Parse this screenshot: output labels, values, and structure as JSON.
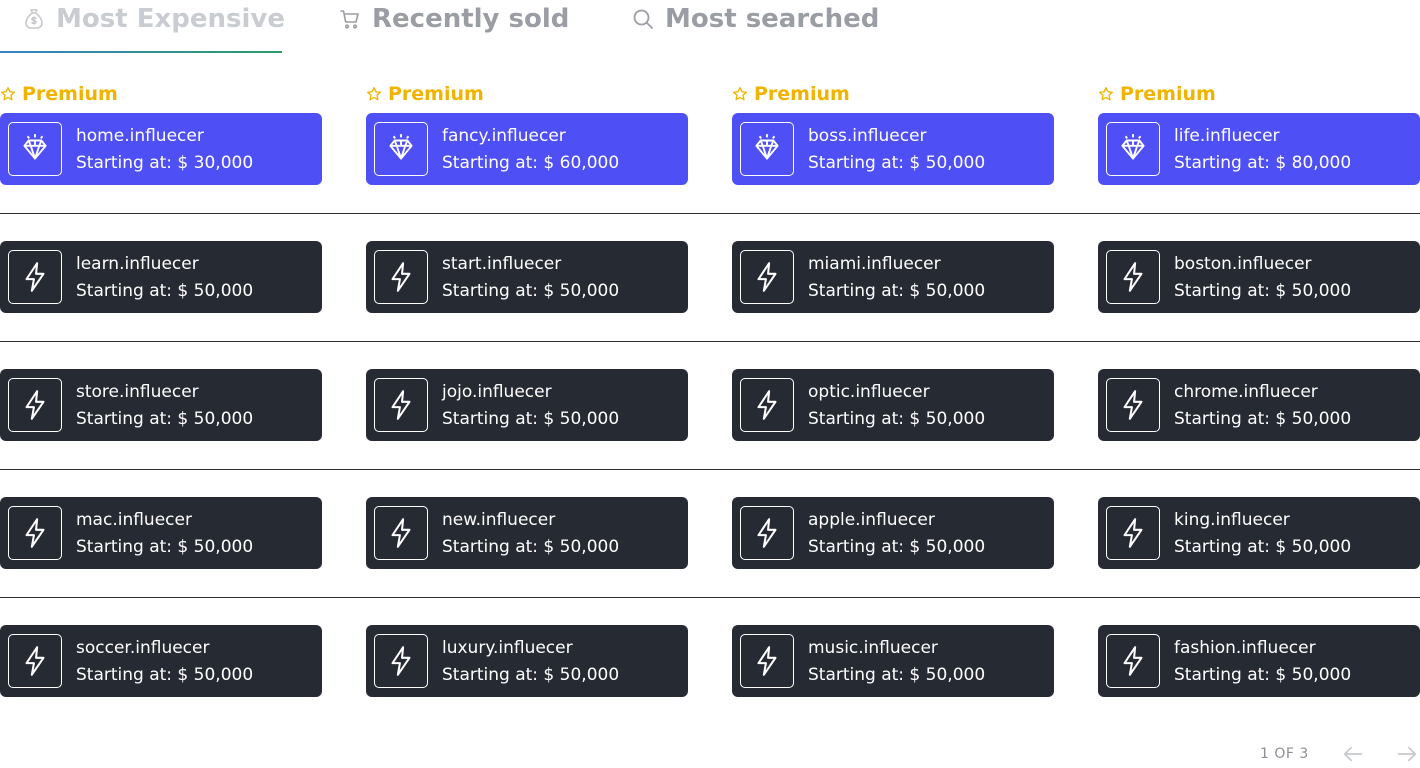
{
  "tabs": [
    {
      "label": "Most Expensive",
      "icon": "money-bag-icon",
      "active": true
    },
    {
      "label": "Recently sold",
      "icon": "cart-icon",
      "active": false
    },
    {
      "label": "Most searched",
      "icon": "search-icon",
      "active": false
    }
  ],
  "premium_label": "Premium",
  "price_prefix": "Starting at:",
  "colors": {
    "premium_card": "#4f4ff6",
    "regular_card": "#252a33",
    "premium_label": "#f0b400",
    "tab_underline_start": "#3b82c4",
    "tab_underline_end": "#2a9d6a"
  },
  "rows": [
    {
      "type": "premium",
      "icon": "diamond-icon",
      "items": [
        {
          "name": "home.influecer",
          "price": "Starting at: $ 30,000"
        },
        {
          "name": "fancy.influecer",
          "price": "Starting at: $ 60,000"
        },
        {
          "name": "boss.influecer",
          "price": "Starting at: $ 50,000"
        },
        {
          "name": "life.influecer",
          "price": "Starting at: $ 80,000"
        }
      ]
    },
    {
      "type": "regular",
      "icon": "lightning-icon",
      "items": [
        {
          "name": "learn.influecer",
          "price": "Starting at: $ 50,000"
        },
        {
          "name": "start.influecer",
          "price": "Starting at: $ 50,000"
        },
        {
          "name": "miami.influecer",
          "price": "Starting at: $ 50,000"
        },
        {
          "name": "boston.influecer",
          "price": "Starting at: $ 50,000"
        }
      ]
    },
    {
      "type": "regular",
      "icon": "lightning-icon",
      "items": [
        {
          "name": "store.influecer",
          "price": "Starting at: $ 50,000"
        },
        {
          "name": "jojo.influecer",
          "price": "Starting at: $ 50,000"
        },
        {
          "name": "optic.influecer",
          "price": "Starting at: $ 50,000"
        },
        {
          "name": "chrome.influecer",
          "price": "Starting at: $ 50,000"
        }
      ]
    },
    {
      "type": "regular",
      "icon": "lightning-icon",
      "items": [
        {
          "name": "mac.influecer",
          "price": "Starting at: $ 50,000"
        },
        {
          "name": "new.influecer",
          "price": "Starting at: $ 50,000"
        },
        {
          "name": "apple.influecer",
          "price": "Starting at: $ 50,000"
        },
        {
          "name": "king.influecer",
          "price": "Starting at: $ 50,000"
        }
      ]
    },
    {
      "type": "regular",
      "icon": "lightning-icon",
      "items": [
        {
          "name": "soccer.influecer",
          "price": "Starting at: $ 50,000"
        },
        {
          "name": "luxury.influecer",
          "price": "Starting at: $ 50,000"
        },
        {
          "name": "music.influecer",
          "price": "Starting at: $ 50,000"
        },
        {
          "name": "fashion.influecer",
          "price": "Starting at: $ 50,000"
        }
      ]
    }
  ],
  "pagination": {
    "label": "1 OF 3",
    "prev_icon": "arrow-left-icon",
    "next_icon": "arrow-right-icon"
  }
}
